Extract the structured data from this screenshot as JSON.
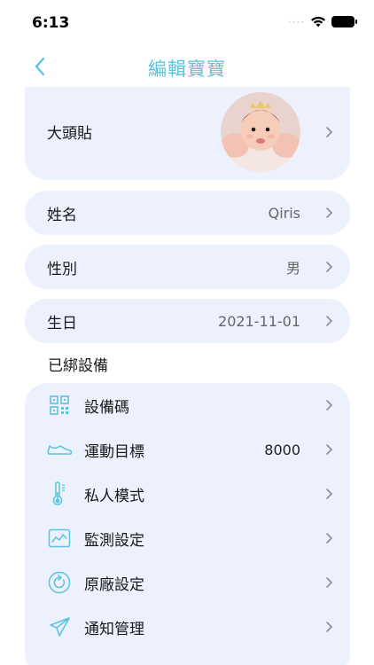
{
  "status_bar": {
    "time": "6:13",
    "signal": "····"
  },
  "nav": {
    "title": "編輯寶寶"
  },
  "profile": {
    "avatar_label": "大頭貼",
    "name_label": "姓名",
    "name_value": "Qiris",
    "gender_label": "性別",
    "gender_value": "男",
    "birthday_label": "生日",
    "birthday_value": "2021-11-01"
  },
  "devices": {
    "section_title": "已綁設備",
    "items": [
      {
        "label": "設備碼",
        "value": "",
        "icon": "qr-code-icon"
      },
      {
        "label": "運動目標",
        "value": "8000",
        "icon": "shoe-icon"
      },
      {
        "label": "私人模式",
        "value": "",
        "icon": "thermometer-icon"
      },
      {
        "label": "監測設定",
        "value": "",
        "icon": "chart-monitor-icon"
      },
      {
        "label": "原廠設定",
        "value": "",
        "icon": "reset-icon"
      },
      {
        "label": "通知管理",
        "value": "",
        "icon": "paper-plane-icon"
      }
    ]
  },
  "colors": {
    "accent": "#5ac3de",
    "card_bg": "#edf1fd"
  }
}
